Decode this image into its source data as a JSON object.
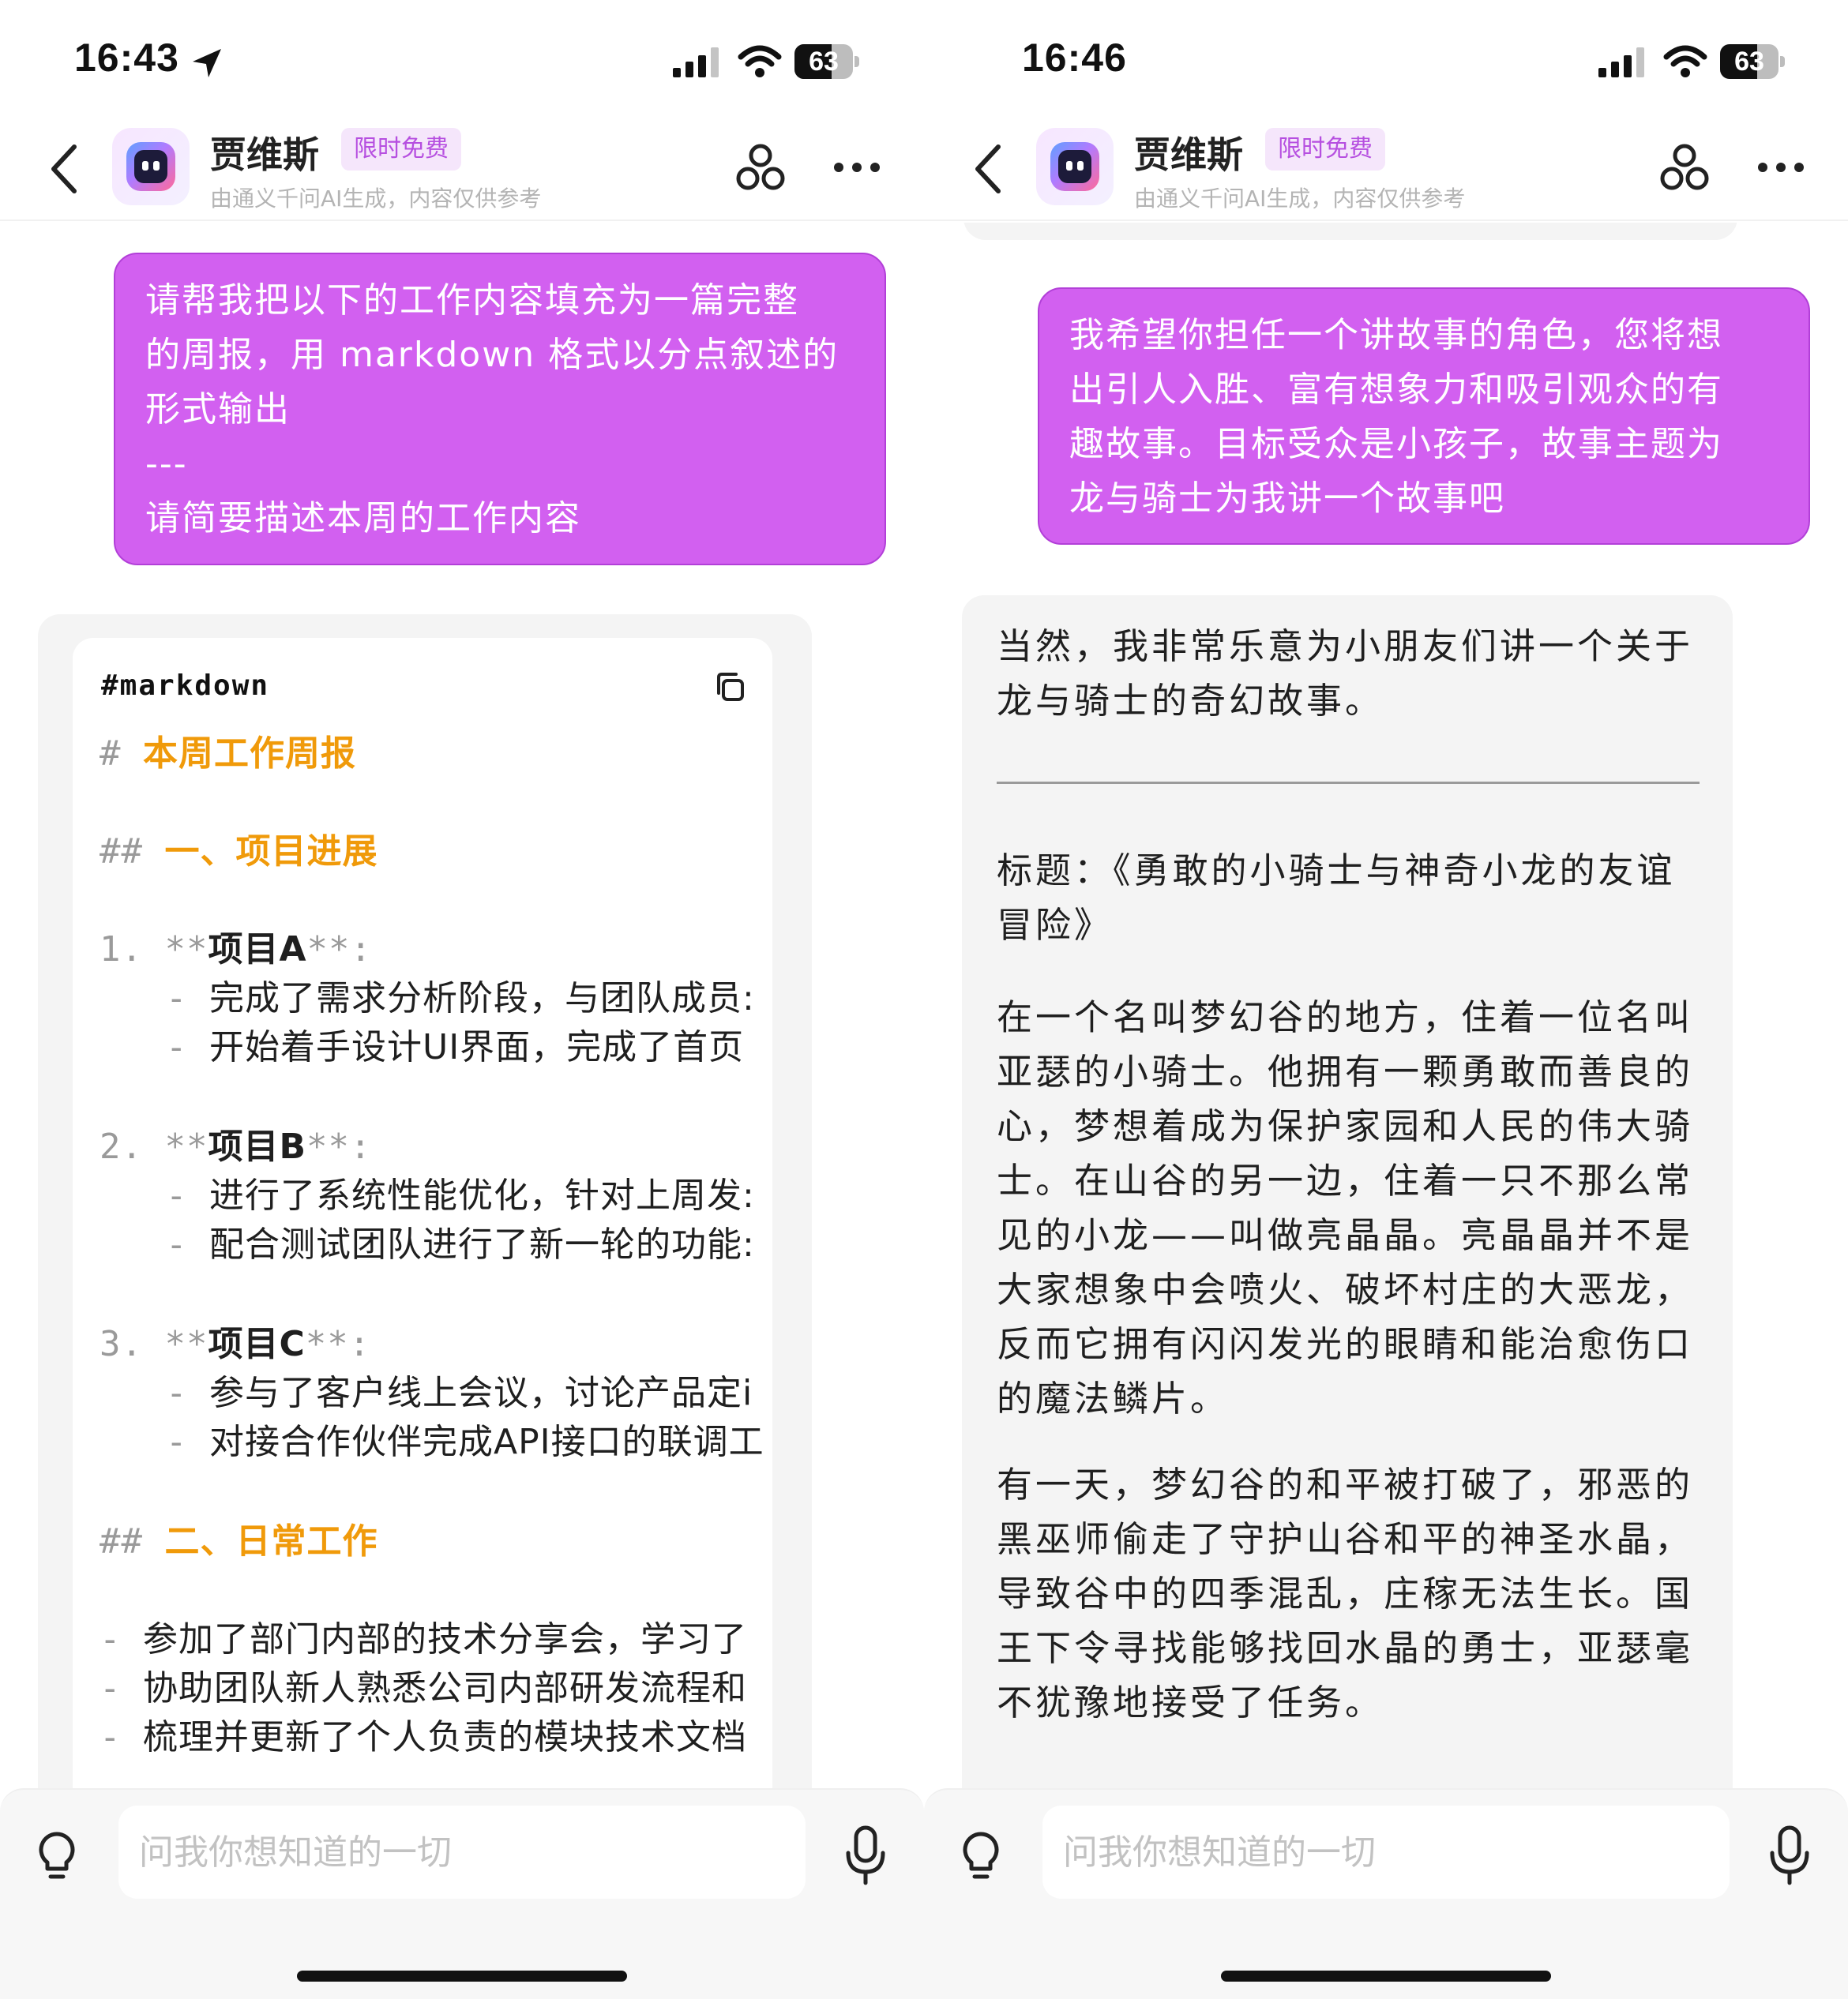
{
  "left": {
    "status": {
      "time": "16:43",
      "battery": "63",
      "battery_level": 0.63
    },
    "header": {
      "title": "贾维斯",
      "badge": "限时免费",
      "subtitle": "由通义千问AI生成，内容仅供参考"
    },
    "user_message": "请帮我把以下的工作内容填充为一篇完整\n的周报，用 markdown 格式以分点叙述的\n形式输出\n---\n请简要描述本周的工作内容",
    "code_block": {
      "language": "#markdown",
      "lines": [
        {
          "mark": "#",
          "text": "本周工作周报",
          "type": "h1"
        },
        {
          "mark": "##",
          "text": "一、项目进展",
          "type": "h2"
        },
        {
          "mark": "1.",
          "pre": "**",
          "text": "项目A",
          "post": "**:",
          "type": "item"
        },
        {
          "mark": "-",
          "text": "完成了需求分析阶段，与团队成员:",
          "type": "sub"
        },
        {
          "mark": "-",
          "text": "开始着手设计UI界面，完成了首页",
          "type": "sub"
        },
        {
          "mark": "2.",
          "pre": "**",
          "text": "项目B",
          "post": "**:",
          "type": "item"
        },
        {
          "mark": "-",
          "text": "进行了系统性能优化，针对上周发:",
          "type": "sub"
        },
        {
          "mark": "-",
          "text": "配合测试团队进行了新一轮的功能:",
          "type": "sub"
        },
        {
          "mark": "3.",
          "pre": "**",
          "text": "项目C",
          "post": "**:",
          "type": "item"
        },
        {
          "mark": "-",
          "text": "参与了客户线上会议，讨论产品定i",
          "type": "sub"
        },
        {
          "mark": "-",
          "text": "对接合作伙伴完成API接口的联调工",
          "type": "sub"
        },
        {
          "mark": "##",
          "text": "二、日常工作",
          "type": "h2"
        },
        {
          "mark": "-",
          "text": "参加了部门内部的技术分享会，学习了",
          "type": "list"
        },
        {
          "mark": "-",
          "text": "协助团队新人熟悉公司内部研发流程和",
          "type": "list"
        },
        {
          "mark": "-",
          "text": "梳理并更新了个人负责的模块技术文档",
          "type": "list"
        }
      ]
    },
    "input": {
      "placeholder": "问我你想知道的一切"
    }
  },
  "right": {
    "status": {
      "time": "16:46",
      "battery": "63",
      "battery_level": 0.63
    },
    "header": {
      "title": "贾维斯",
      "badge": "限时免费",
      "subtitle": "由通义千问AI生成，内容仅供参考"
    },
    "user_message": "我希望你担任一个讲故事的角色，您将想\n出引人入胜、富有想象力和吸引观众的有\n趣故事。目标受众是小孩子，故事主题为\n龙与骑士为我讲一个故事吧",
    "reply": {
      "intro": "当然，我非常乐意为小朋友们讲一个关于龙与骑士的奇幻故事。",
      "title": "标题：《勇敢的小骑士与神奇小龙的友谊冒险》",
      "para1": "在一个名叫梦幻谷的地方，住着一位名叫亚瑟的小骑士。他拥有一颗勇敢而善良的心，梦想着成为保护家园和人民的伟大骑士。在山谷的另一边，住着一只不那么常见的小龙——叫做亮晶晶。亮晶晶并不是大家想象中会喷火、破坏村庄的大恶龙，反而它拥有闪闪发光的眼睛和能治愈伤口的魔法鳞片。",
      "para2": "有一天，梦幻谷的和平被打破了，邪恶的黑巫师偷走了守护山谷和平的神圣水晶，导致谷中的四季混乱，庄稼无法生长。国王下令寻找能够找回水晶的勇士，亚瑟毫不犹豫地接受了任务。"
    },
    "input": {
      "placeholder": "问我你想知道的一切"
    }
  }
}
